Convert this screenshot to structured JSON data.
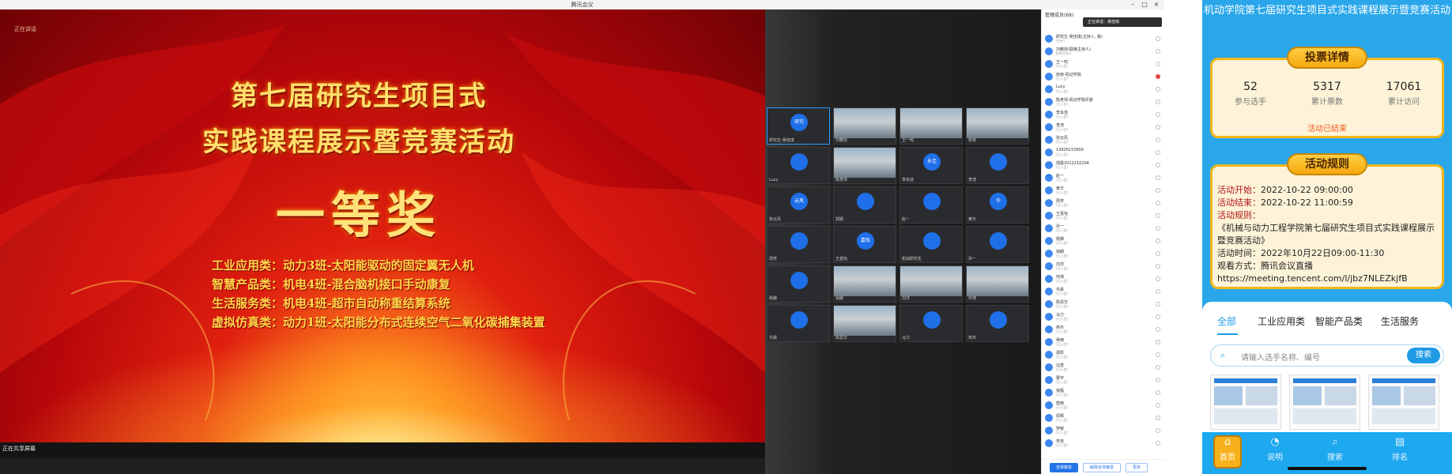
{
  "meeting": {
    "window_title": "腾讯会议",
    "slide": {
      "corner_tag": "正在讲话",
      "title_line1": "第七届研究生项目式",
      "title_line2": "实践课程展示暨竞赛活动",
      "award": "一等奖",
      "winners": [
        "工业应用类：动力3班-太阳能驱动的固定翼无人机",
        "智慧产品类：机电4班-混合脑机接口手动康复",
        "生活服务类：机电4班-超市自动称重结算系统",
        "虚拟仿真类：动力1班-太阳能分布式连续空气二氧化碳捕集装置"
      ],
      "bottom_label": "正在共享屏幕"
    },
    "gallery": [
      {
        "label": "研究",
        "name": "研究生-吴佳琪"
      },
      {
        "label": "",
        "name": "刘教授"
      },
      {
        "label": "",
        "name": "王一鸣"
      },
      {
        "label": "",
        "name": "张晓"
      },
      {
        "label": "",
        "name": "Lucy"
      },
      {
        "label": "",
        "name": "陈老师"
      },
      {
        "label": "永佳",
        "name": "李永佳"
      },
      {
        "label": "",
        "name": "李浩"
      },
      {
        "label": "云风",
        "name": "张云风"
      },
      {
        "label": "",
        "name": "郭晨"
      },
      {
        "label": "",
        "name": "赵一"
      },
      {
        "label": "华",
        "name": "黄华"
      },
      {
        "label": "",
        "name": "周芳"
      },
      {
        "label": "嘉怡",
        "name": "王嘉怡"
      },
      {
        "label": "",
        "name": "机动研究生"
      },
      {
        "label": "",
        "name": "孙一"
      },
      {
        "label": "",
        "name": "杨娜"
      },
      {
        "label": "",
        "name": "徐朗"
      },
      {
        "label": "",
        "name": "刘洋"
      },
      {
        "label": "",
        "name": "何涛"
      },
      {
        "label": "",
        "name": "许晨"
      },
      {
        "label": "恩华",
        "name": "陈恩华"
      },
      {
        "label": "",
        "name": "马力"
      },
      {
        "label": "",
        "name": "林杰"
      }
    ],
    "members": {
      "header": "管理成员(68)",
      "speaking_badge": "正在讲话：吴佳琪",
      "list": [
        {
          "name": "研究生-吴佳琪(主持人, 我)",
          "sub": "主持人"
        },
        {
          "name": "刘教授(联席主持人)",
          "sub": "联席主持人"
        },
        {
          "name": "王一鸣",
          "sub": "(已入会)"
        },
        {
          "name": "张晓-机动学院",
          "sub": "(已入会)"
        },
        {
          "name": "Lucy",
          "sub": "(已入会)"
        },
        {
          "name": "陈老师-机动学院评委",
          "sub": "(已入会)"
        },
        {
          "name": "李永佳",
          "sub": "(已入会)"
        },
        {
          "name": "李浩",
          "sub": "(已入会)"
        },
        {
          "name": "张云风",
          "sub": "(已入会)"
        },
        {
          "name": "13926153800",
          "sub": "(已入会)"
        },
        {
          "name": "郭晨2022210204",
          "sub": "(已入会)"
        },
        {
          "name": "赵一",
          "sub": "(已入会)"
        },
        {
          "name": "黄华",
          "sub": "(已入会)"
        },
        {
          "name": "周芳",
          "sub": "(已入会)"
        },
        {
          "name": "王嘉怡",
          "sub": "(已入会)"
        },
        {
          "name": "孙一",
          "sub": "(已入会)"
        },
        {
          "name": "杨娜",
          "sub": "(已入会)"
        },
        {
          "name": "徐朗",
          "sub": "(已入会)"
        },
        {
          "name": "刘洋",
          "sub": "(已入会)"
        },
        {
          "name": "何涛",
          "sub": "(已入会)"
        },
        {
          "name": "许晨",
          "sub": "(已入会)"
        },
        {
          "name": "陈恩华",
          "sub": "(已入会)"
        },
        {
          "name": "马力",
          "sub": "(已入会)"
        },
        {
          "name": "林杰",
          "sub": "(已入会)"
        },
        {
          "name": "吴楠",
          "sub": "(已入会)"
        },
        {
          "name": "郑凯",
          "sub": "(已入会)"
        },
        {
          "name": "冯雪",
          "sub": "(已入会)"
        },
        {
          "name": "曹宇",
          "sub": "(已入会)"
        },
        {
          "name": "钱程",
          "sub": "(已入会)"
        },
        {
          "name": "唐雨",
          "sub": "(已入会)"
        },
        {
          "name": "邓辉",
          "sub": "(已入会)"
        },
        {
          "name": "罗敏",
          "sub": "(已入会)"
        },
        {
          "name": "宋佳",
          "sub": "(已入会)"
        }
      ],
      "footer_buttons": [
        "全体静音",
        "解除全体静音",
        "更多"
      ]
    }
  },
  "phone": {
    "title": "机动学院第七届研究生项目式实践课程展示暨竞赛活动",
    "vote_pill": "投票详情",
    "stats": [
      {
        "num": "52",
        "label": "参与选手"
      },
      {
        "num": "5317",
        "label": "累计票数"
      },
      {
        "num": "17061",
        "label": "累计访问"
      }
    ],
    "ended": "活动已结束",
    "rules_pill": "活动规则",
    "rules": {
      "start_label": "活动开始：",
      "start": "2022-10-22 09:00:00",
      "end_label": "活动结束：",
      "end": "2022-10-22 11:00:59",
      "rules_label": "活动规则：",
      "line1": "《机械与动力工程学院第七届研究生项目式实践课程展示暨竞赛活动》",
      "line2": "活动时间：2022年10月22日09:00-11:30",
      "line3": "观看方式：腾讯会议直播",
      "line4": "https://meeting.tencent.com/l/jbz7NLEZkjfB"
    },
    "tabs": [
      "全部",
      "工业应用类",
      "智能产品类",
      "生活服务"
    ],
    "search_placeholder": "请输入选手名称、编号",
    "search_button": "搜索",
    "nav": [
      {
        "icon": "⌂",
        "label": "首页"
      },
      {
        "icon": "◔",
        "label": "说明"
      },
      {
        "icon": "⌕",
        "label": "搜索"
      },
      {
        "icon": "▤",
        "label": "排名"
      }
    ]
  }
}
